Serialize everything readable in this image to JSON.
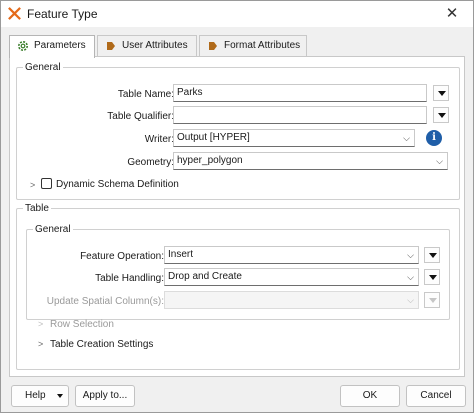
{
  "window": {
    "title": "Feature Type",
    "close_symbol": "✕"
  },
  "tabs": [
    {
      "label": "Parameters",
      "icon": "gear-icon",
      "active": true
    },
    {
      "label": "User Attributes",
      "icon": "arrow-tag-icon",
      "active": false
    },
    {
      "label": "Format Attributes",
      "icon": "arrow-tag-icon",
      "active": false
    }
  ],
  "general": {
    "legend": "General",
    "table_name_label": "Table Name:",
    "table_name_value": "Parks",
    "table_qualifier_label": "Table Qualifier:",
    "table_qualifier_value": "",
    "writer_label": "Writer:",
    "writer_value": "Output [HYPER]",
    "geometry_label": "Geometry:",
    "geometry_value": "hyper_polygon",
    "dynamic_schema_label": "Dynamic Schema Definition",
    "dynamic_schema_checked": false
  },
  "table": {
    "legend": "Table",
    "general_legend": "General",
    "feature_operation_label": "Feature Operation:",
    "feature_operation_value": "Insert",
    "table_handling_label": "Table Handling:",
    "table_handling_value": "Drop and Create",
    "update_spatial_label": "Update Spatial Column(s):",
    "update_spatial_value": "",
    "row_selection_label": "Row Selection",
    "table_creation_label": "Table Creation Settings"
  },
  "footer": {
    "help_label": "Help",
    "apply_label": "Apply to...",
    "ok_label": "OK",
    "cancel_label": "Cancel"
  },
  "colors": {
    "info_icon": "#1f5ea8",
    "gear_icon": "#3a7d2b",
    "tag_icon": "#b06a1a"
  }
}
